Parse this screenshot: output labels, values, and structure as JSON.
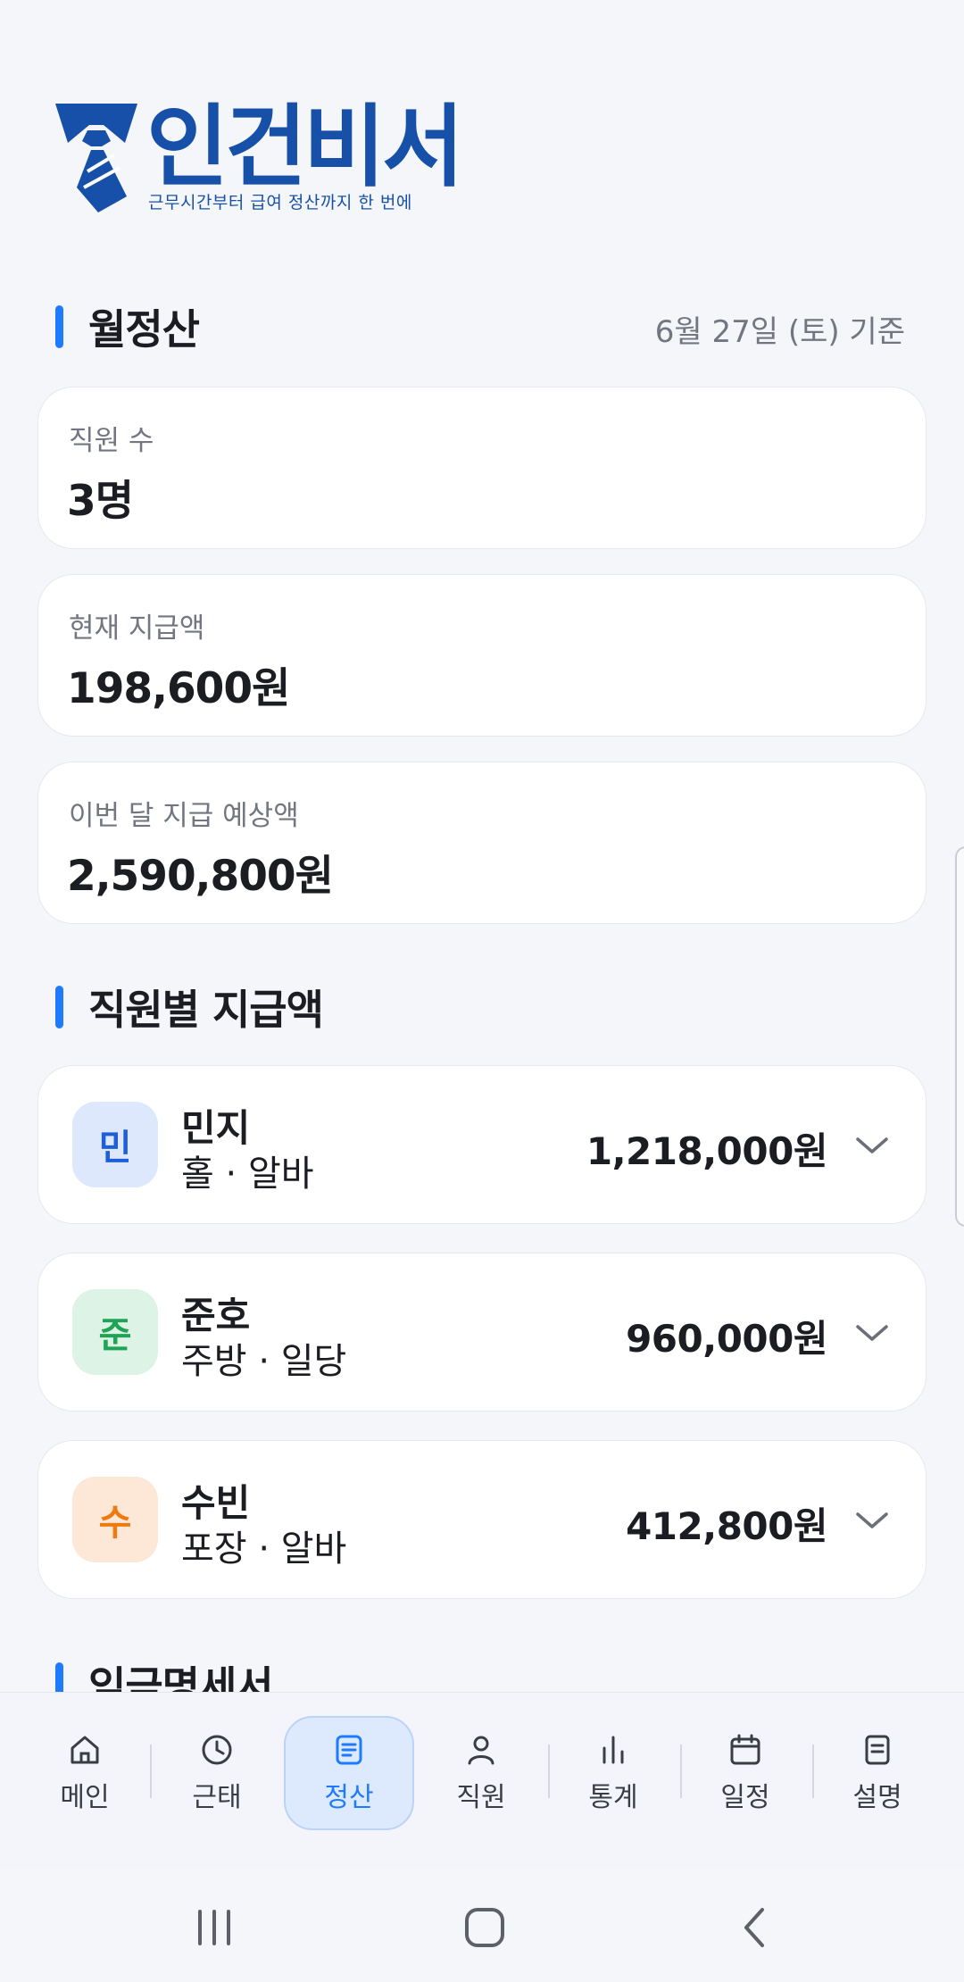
{
  "logo": {
    "name": "인건비서",
    "tagline": "근무시간부터 급여 정산까지 한 번에",
    "brand_color": "#1650a8"
  },
  "monthly": {
    "title": "월정산",
    "basis_date": "6월 27일 (토) 기준",
    "cards": [
      {
        "label": "직원 수",
        "value": "3명"
      },
      {
        "label": "현재 지급액",
        "value": "198,600원"
      },
      {
        "label": "이번 달 지급 예상액",
        "value": "2,590,800원"
      }
    ]
  },
  "employees": {
    "title": "직원별 지급액",
    "items": [
      {
        "initial": "민",
        "name": "민지",
        "role": "홀 · 알바",
        "amount": "1,218,000원",
        "avatar_bg": "#dde8fd",
        "avatar_fg": "#1e5fd8",
        "icon": "chevron-down-icon"
      },
      {
        "initial": "준",
        "name": "준호",
        "role": "주방 · 일당",
        "amount": "960,000원",
        "avatar_bg": "#dcf3e5",
        "avatar_fg": "#1fa356",
        "icon": "chevron-down-icon"
      },
      {
        "initial": "수",
        "name": "수빈",
        "role": "포장 · 알바",
        "amount": "412,800원",
        "avatar_bg": "#fde7d6",
        "avatar_fg": "#ee7b12",
        "icon": "chevron-down-icon"
      }
    ]
  },
  "payslip": {
    "title": "임금명세서"
  },
  "nav": {
    "items": [
      {
        "label": "메인",
        "icon": "home-icon"
      },
      {
        "label": "근태",
        "icon": "clock-icon"
      },
      {
        "label": "정산",
        "icon": "document-icon",
        "active": true
      },
      {
        "label": "직원",
        "icon": "person-icon"
      },
      {
        "label": "통계",
        "icon": "bar-chart-icon"
      },
      {
        "label": "일정",
        "icon": "calendar-icon"
      },
      {
        "label": "설명",
        "icon": "note-icon"
      }
    ]
  },
  "system_nav": [
    "recent-apps-icon",
    "home-button-icon",
    "back-icon"
  ],
  "accent_color": "#1e7bff"
}
